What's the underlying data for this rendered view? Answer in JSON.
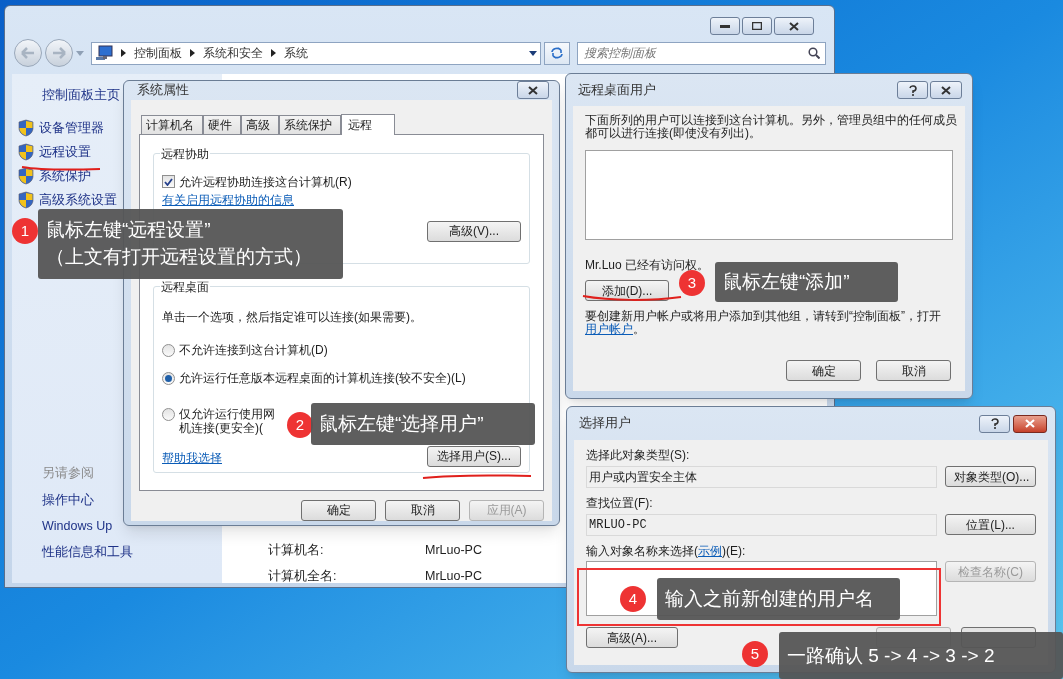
{
  "explorer": {
    "breadcrumbs": [
      "控制面板",
      "系统和安全",
      "系统"
    ],
    "search": {
      "placeholder": "搜索控制面板"
    },
    "sidebar": {
      "home": "控制面板主页",
      "tasks": [
        "设备管理器",
        "远程设置",
        "系统保护",
        "高级系统设置"
      ],
      "see_also_title": "另请参阅",
      "see_also": [
        "操作中心",
        "Windows Up",
        "性能信息和工具"
      ]
    },
    "info_rows": [
      {
        "label": "计算机名:",
        "value": "MrLuo-PC"
      },
      {
        "label": "计算机全名:",
        "value": "MrLuo-PC"
      }
    ]
  },
  "system_properties": {
    "title": "系统属性",
    "tabs": [
      {
        "label": "计算机名",
        "selected": false
      },
      {
        "label": "硬件",
        "selected": false
      },
      {
        "label": "高级",
        "selected": false
      },
      {
        "label": "系统保护",
        "selected": false
      },
      {
        "label": "远程",
        "selected": true
      }
    ],
    "remote_assistance": {
      "title": "远程协助",
      "checkbox": {
        "label": "允许远程协助连接这台计算机(R)",
        "checked": true
      },
      "link": "有关启用远程协助的信息",
      "button": "高级(V)..."
    },
    "remote_desktop": {
      "title": "远程桌面",
      "instruction": "单击一个选项，然后指定谁可以连接(如果需要)。",
      "options": [
        {
          "label": "不允许连接到这台计算机(D)",
          "selected": false
        },
        {
          "label": "允许运行任意版本远程桌面的计算机连接(较不安全)(L)",
          "selected": true
        },
        {
          "label": "仅允许运行使用网",
          "label_line_2": "机连接(更安全)(",
          "selected": false
        }
      ],
      "help_link": "帮助我选择",
      "button": "选择用户(S)..."
    },
    "buttons": [
      {
        "label": "确定",
        "disabled": false
      },
      {
        "label": "取消",
        "disabled": false
      },
      {
        "label": "应用(A)",
        "disabled": true
      }
    ]
  },
  "remote_desktop_users": {
    "title": "远程桌面用户",
    "description": "下面所列的用户可以连接到这台计算机。另外，管理员组中的任何成员都可以进行连接(即使没有列出)。",
    "access_note": "Mr.Luo 已经有访问权。",
    "add_button": "添加(D)...",
    "footer_before": "要创建新用户帐户或将用户添加到其他组，请转到“控制面板”，打开",
    "footer_link": "用户帐户",
    "footer_after": "。",
    "buttons": [
      "确定",
      "取消"
    ]
  },
  "select_users": {
    "title": "选择用户",
    "object_type_label": "选择此对象类型(S):",
    "object_type": "用户或内置安全主体",
    "object_type_button": "对象类型(O)...",
    "location_label": "查找位置(F):",
    "location": "MRLUO-PC",
    "location_button": "位置(L)...",
    "names_label_before": "输入对象名称来选择(",
    "names_label_link": "示例",
    "names_label_after": ")(E):",
    "check_names_button": "检查名称(C)",
    "advanced_button": "高级(A)..."
  },
  "callouts": [
    {
      "number": "1",
      "lines": [
        "鼠标左键“远程设置”",
        "（上文有打开远程设置的方式）"
      ]
    },
    {
      "number": "2",
      "lines": [
        "鼠标左键“选择用户”"
      ]
    },
    {
      "number": "3",
      "lines": [
        "鼠标左键“添加”"
      ]
    },
    {
      "number": "4",
      "lines": [
        "输入之前新创建的用户名"
      ]
    },
    {
      "number": "5",
      "lines": [
        "一路确认 5 -> 4 -> 3 -> 2"
      ]
    }
  ]
}
